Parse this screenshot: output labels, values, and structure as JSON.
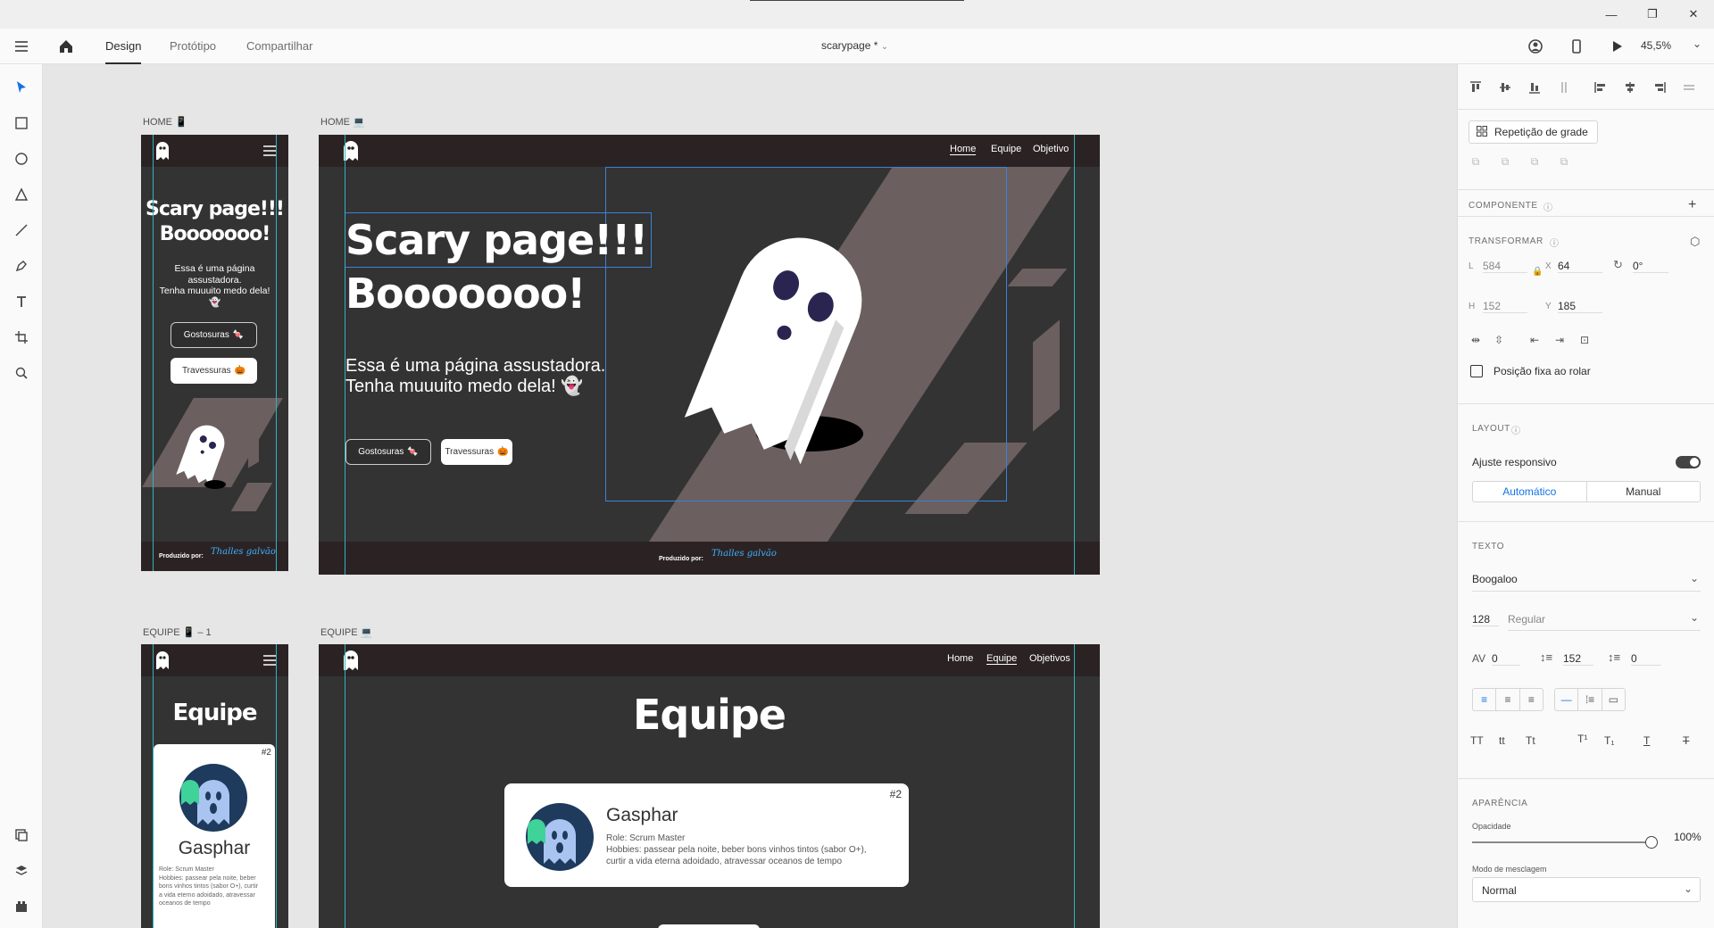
{
  "topbar": {
    "tabs": [
      "Design",
      "Protótipo",
      "Compartilhar"
    ],
    "document_title": "scarypage *",
    "zoom": "45,5%"
  },
  "artboards": {
    "home_mobile_label": "HOME 📱",
    "home_desktop_label": "HOME 💻",
    "equipe_mobile_label": "EQUIPE 📱 – 1",
    "equipe_desktop_label": "EQUIPE 💻"
  },
  "home": {
    "nav": [
      "Home",
      "Equipe",
      "Objetivo"
    ],
    "title_line1": "Scary page!!!",
    "title_line2": "Booooooo!",
    "subtitle_line1": "Essa é uma página assustadora.",
    "subtitle_line2": "Tenha muuuito medo dela!",
    "mobile_subtitle_line1": "Essa é uma página",
    "mobile_subtitle_line2": "assustadora.",
    "mobile_subtitle_line3": "Tenha muuuito medo dela!",
    "btn_gostosuras": "Gostosuras",
    "btn_travessuras": "Travessuras",
    "footer_prefix": "Produzido por:",
    "footer_signature": "Thalles galvão"
  },
  "equipe": {
    "nav": [
      "Home",
      "Equipe",
      "Objetivos"
    ],
    "title": "Equipe",
    "card_number": "#2",
    "member_name": "Gasphar",
    "member_role": "Role: Scrum Master",
    "member_hobbies": "Hobbies: passear pela noite, beber bons vinhos tintos (sabor O+),",
    "member_hobbies_2": "curtir a vida eterna adoidado, atravessar oceanos de tempo",
    "mobile_role": "Role: Scrum Master",
    "mobile_hobbies_1": "Hobbies: passear pela noite, beber",
    "mobile_hobbies_2": "bons vinhos tintos (sabor O+), curtir",
    "mobile_hobbies_3": "a vida eterno adoidado, atravessar",
    "mobile_hobbies_4": "oceanos de tempo"
  },
  "inspector": {
    "repeat_grid": "Repetição de grade",
    "componente": "COMPONENTE",
    "transformar": "TRANSFORMAR",
    "w_label": "L",
    "w": "584",
    "x_label": "X",
    "x": "64",
    "rotation": "0°",
    "h_label": "H",
    "h": "152",
    "y_label": "Y",
    "y": "185",
    "fixed_position": "Posição fixa ao rolar",
    "layout": "LAYOUT",
    "responsive": "Ajuste responsivo",
    "auto": "Automático",
    "manual": "Manual",
    "texto": "TEXTO",
    "font": "Boogaloo",
    "font_size": "128",
    "font_weight": "Regular",
    "char_spacing": "0",
    "line_spacing": "152",
    "para_spacing": "0",
    "aparencia": "APARÊNCIA",
    "opacity_label": "Opacidade",
    "opacity": "100%",
    "opacity_value": 1.0,
    "blend_label": "Modo de mesclagem",
    "blend": "Normal"
  },
  "colors": {
    "accent": "#1473e6",
    "guide": "#2fb3c0",
    "board_bg": "#333333",
    "nav_bg": "#2b2323",
    "shape": "#6b5f5f"
  }
}
